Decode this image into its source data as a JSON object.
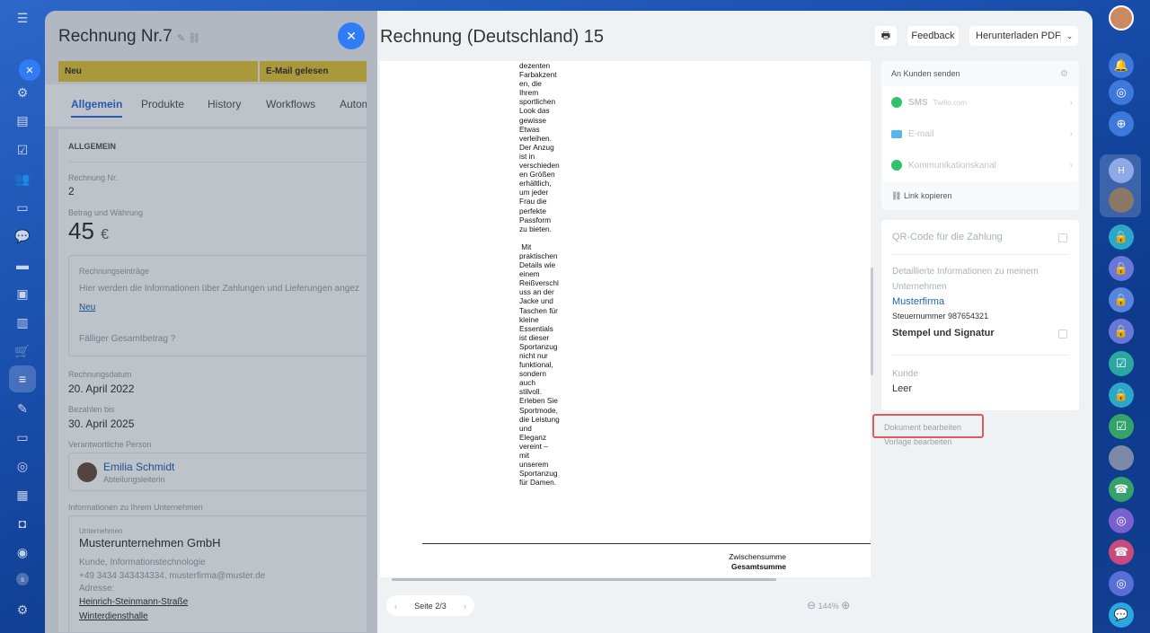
{
  "left_sidebar": {
    "icons": [
      "menu-icon",
      "close-icon",
      "gear-icon",
      "document-icon",
      "checkbox-icon",
      "contacts-icon",
      "file-icon",
      "chat-icon",
      "box-icon",
      "picture-icon",
      "bar-chart-icon",
      "cart-icon",
      "filter-icon",
      "edit-icon",
      "card-icon",
      "target-icon",
      "calendar-icon",
      "robot-icon",
      "goal-icon",
      "status-icon",
      "settings-icon"
    ],
    "avatar_letter": "s"
  },
  "right_sidebar": {
    "icons": [
      "user-avatar",
      "bell-icon",
      "target-icon",
      "search-chat-icon",
      "h-badge",
      "person-avatar",
      "lock-icon",
      "lock-icon",
      "lock-icon",
      "lock-icon",
      "check-icon",
      "lock-icon",
      "check-icon",
      "group-avatar",
      "phone-icon",
      "target-icon",
      "phone-icon",
      "target-icon",
      "chat-icon"
    ],
    "h_letter": "H"
  },
  "crm": {
    "title": "Rechnung Nr.7",
    "stages": [
      "Neu",
      "E-Mail gelesen"
    ],
    "tabs": [
      "Allgemein",
      "Produkte",
      "History",
      "Workflows",
      "Autom"
    ],
    "section_header": "ALLGEMEIN",
    "invoice_number_label": "Rechnung Nr.",
    "invoice_number": "2",
    "amount_label": "Betrag und Währung",
    "amount": "45",
    "currency": "€",
    "items_label": "Rechnungseinträge",
    "items_text": "Hier werden die Informationen über Zahlungen und Lieferungen angez",
    "new_link": "Neu",
    "total_due": "Fälliger Gesamtbetrag",
    "invoice_date_label": "Rechnungsdatum",
    "invoice_date": "20. April 2022",
    "pay_until_label": "Bezahlen bis",
    "pay_until": "30. April 2025",
    "responsible_label": "Verantwortliche Person",
    "responsible_name": "Emilia Schmidt",
    "responsible_role": "Abteilungsleiterin",
    "company_info_label": "Informationen zu Ihrem Unternehmen",
    "company_label": "Unternehmen",
    "company_name": "Musterunternehmen GmbH",
    "company_type": "Kunde, Informationstechnologie",
    "company_contact": "+49 3434 343434334, musterfirma@muster.de",
    "address_label": "Adresse:",
    "address_line1": "Heinrich-Steinmann-Straße",
    "address_line2": "Winterdiensthalle"
  },
  "slider": {
    "title": "Rechnung (Deutschland) 15",
    "print_label": "🖶",
    "feedback_label": "Feedback",
    "download_label": "Herunterladen PDF",
    "document_text": "dezenten\nFarbakzent\nen, die\nIhrem\nsportlichen\nLook das\ngewisse\nEtwas\nverleihen.\nDer Anzug\nist in\nverschieden\nen Größen\nerhältlich,\num jeder\nFrau die\nperfekte\nPassform\nzu bieten.\n\n Mit\npraktischen\nDetails wie\neinem\nReißverschl\nuss an der\nJacke und\nTaschen für\nkleine\nEssentials\nist dieser\nSportanzug\nnicht nur\nfunktional,\nsondern\nauch\nstilvoll.\nErleben Sie\nSportmode,\ndie Leistung\nund\nEleganz\nvereint –\nmit\nunserem\nSportanzug\nfür Damen.",
    "subtotal_label": "Zwischensumme",
    "total_label": "Gesamtsumme",
    "page_label": "Seite 2/3",
    "zoom": "144%",
    "send_header": "An Kunden senden",
    "channels": [
      {
        "label": "SMS",
        "sub": "Twilio.com",
        "color": "#2fc26e"
      },
      {
        "label": "E-mail",
        "sub": "",
        "color": "#55b8ea"
      },
      {
        "label": "Kommunikationskanal",
        "sub": "",
        "color": "#2fc26e"
      }
    ],
    "copy_link": "Link kopieren",
    "qr_label": "QR-Code für die Zahlung",
    "details_label": "Detaillierte Informationen zu meinem Unternehmen",
    "company_link": "Musterfirma",
    "tax_number": "Steuernummer 987654321",
    "stamp_label": "Stempel und Signatur",
    "customer_label": "Kunde",
    "customer_value": "Leer",
    "edit_document": "Dokument bearbeiten",
    "edit_template": "Vorlage bearbeiten"
  }
}
